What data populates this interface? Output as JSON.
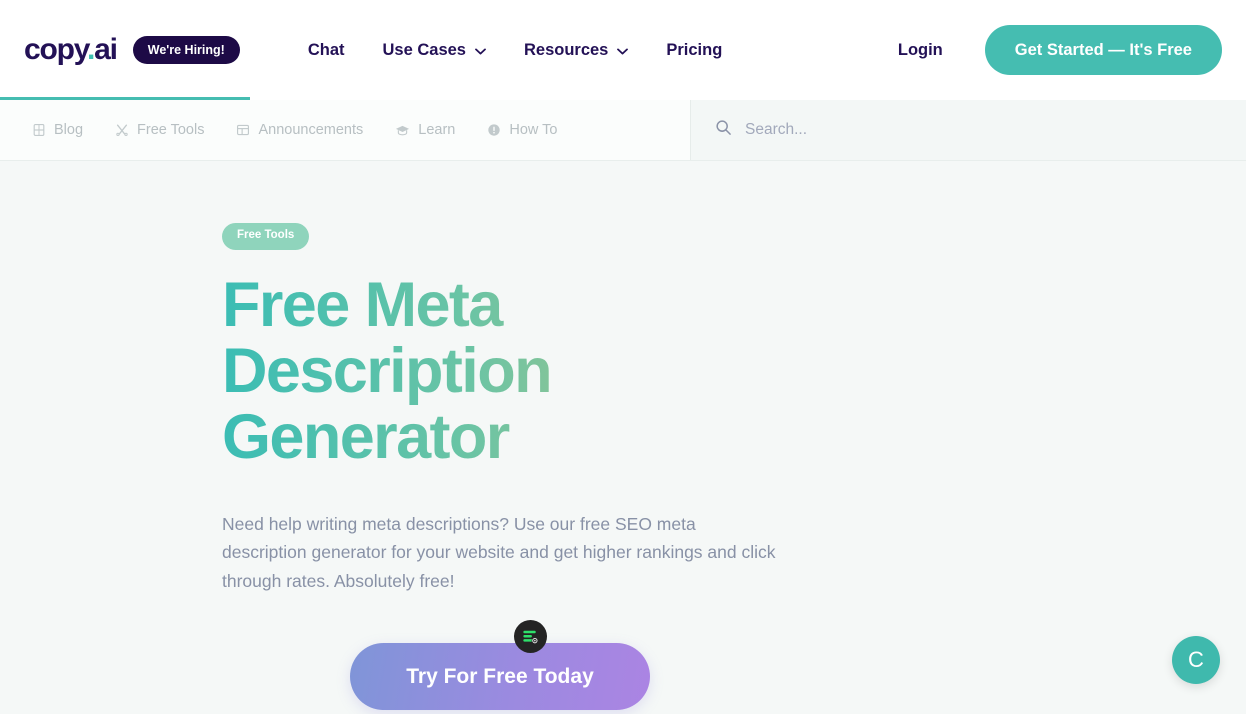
{
  "header": {
    "logo": {
      "name": "copy",
      "dot": ".",
      "suffix": "ai"
    },
    "hiring_badge": "We're Hiring!",
    "nav": [
      {
        "label": "Chat",
        "has_dropdown": false,
        "icon": ""
      },
      {
        "label": "Use Cases",
        "has_dropdown": true,
        "icon": "chevron-down-icon"
      },
      {
        "label": "Resources",
        "has_dropdown": true,
        "icon": "chevron-down-icon"
      },
      {
        "label": "Pricing",
        "has_dropdown": false,
        "icon": ""
      }
    ],
    "login_label": "Login",
    "cta_label": "Get Started — It's Free"
  },
  "subnav": {
    "items": [
      {
        "label": "Blog",
        "icon": "book-icon"
      },
      {
        "label": "Free Tools",
        "icon": "tools-icon"
      },
      {
        "label": "Announcements",
        "icon": "layout-icon"
      },
      {
        "label": "Learn",
        "icon": "graduation-cap-icon"
      },
      {
        "label": "How To",
        "icon": "info-circle-icon"
      }
    ],
    "search": {
      "placeholder": "Search...",
      "value": "",
      "icon": "search-icon"
    }
  },
  "hero": {
    "badge": "Free Tools",
    "title": "Free Meta Description Generator",
    "subtitle": "Need help writing meta descriptions? Use our free SEO meta description generator for your website and get higher rankings and click through rates. Absolutely free!",
    "cta_label": "Try For Free Today"
  },
  "widgets": {
    "extension_icon": "green-bars-settings-icon",
    "chat_launcher_glyph": "C"
  },
  "colors": {
    "brand_teal": "#45bdb1",
    "brand_navy": "#231156",
    "badge_green": "#8fd4bc",
    "cta_gradient_start": "#7f95d8",
    "cta_gradient_end": "#ab84e3",
    "title_gradient_start": "#3bbdb4",
    "title_gradient_end": "#b6c882",
    "page_background": "#f5f8f7"
  }
}
